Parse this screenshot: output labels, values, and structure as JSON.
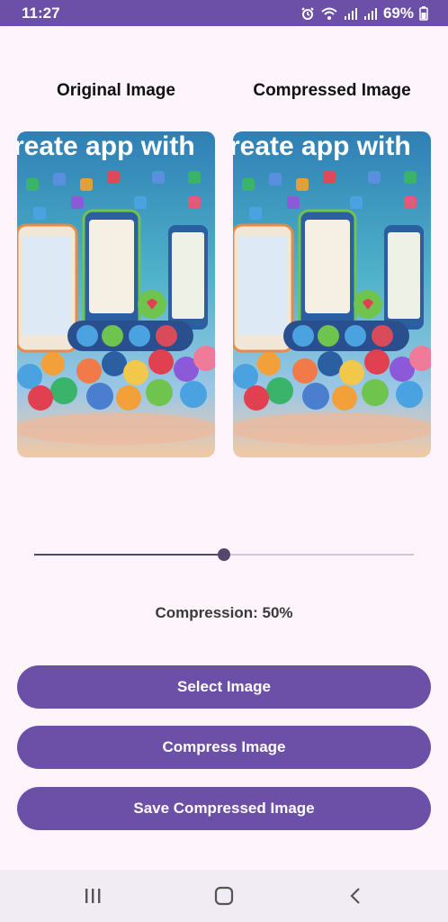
{
  "status_bar": {
    "time": "11:27",
    "battery": "69%",
    "icons": [
      "alarm-icon",
      "wifi-icon",
      "signal-icon",
      "signal-icon",
      "battery-icon"
    ]
  },
  "images": {
    "original_label": "Original Image",
    "compressed_label": "Compressed Image",
    "banner_text": "reate app with"
  },
  "compression": {
    "level": 50,
    "label": "Compression: 50%"
  },
  "buttons": {
    "select": "Select Image",
    "compress": "Compress Image",
    "save": "Save Compressed Image"
  },
  "navbar": {
    "icons": [
      "recents-icon",
      "home-icon",
      "back-icon"
    ]
  },
  "colors": {
    "accent": "#6c4fa6",
    "background": "#fdf5fb",
    "slider_active": "#55466e",
    "slider_inactive": "#cfc7d6"
  }
}
